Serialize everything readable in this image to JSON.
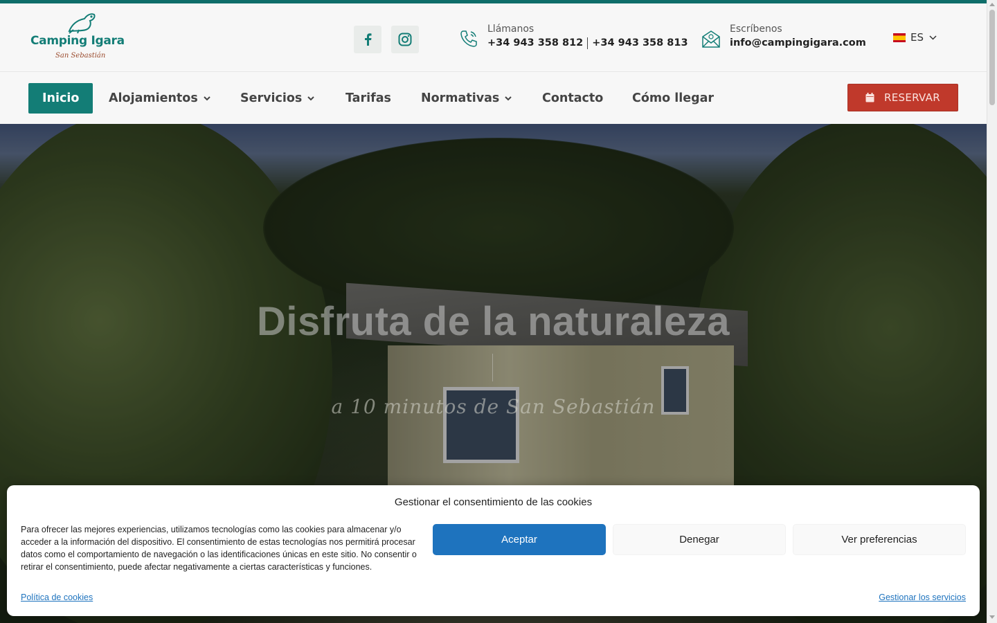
{
  "brand": {
    "name": "Camping Igara",
    "tagline": "San Sebastián",
    "color": "#137d76"
  },
  "header": {
    "social": [
      {
        "name": "facebook-icon"
      },
      {
        "name": "instagram-icon"
      }
    ],
    "phone": {
      "label": "Llámanos",
      "number1": "+34 943 358 812",
      "number2": "+34 943 358 813"
    },
    "email": {
      "label": "Escríbenos",
      "address": "info@campingigara.com"
    },
    "language": {
      "code": "ES",
      "flag": "spain-flag-icon"
    }
  },
  "nav": {
    "items": [
      {
        "label": "Inicio",
        "active": true
      },
      {
        "label": "Alojamientos",
        "dropdown": true
      },
      {
        "label": "Servicios",
        "dropdown": true
      },
      {
        "label": "Tarifas"
      },
      {
        "label": "Normativas",
        "dropdown": true
      },
      {
        "label": "Contacto"
      },
      {
        "label": "Cómo llegar"
      }
    ],
    "reserve_label": "RESERVAR",
    "reserve_color": "#c0392b"
  },
  "hero": {
    "title": "Disfruta de la naturaleza",
    "subtitle": "a 10 minutos de San Sebastián"
  },
  "cookie": {
    "title": "Gestionar el consentimiento de las cookies",
    "text": "Para ofrecer las mejores experiencias, utilizamos tecnologías como las cookies para almacenar y/o acceder a la información del dispositivo. El consentimiento de estas tecnologías nos permitirá procesar datos como el comportamiento de navegación o las identificaciones únicas en este sitio. No consentir o retirar el consentimiento, puede afectar negativamente a ciertas características y funciones.",
    "accept_label": "Aceptar",
    "deny_label": "Denegar",
    "prefs_label": "Ver preferencias",
    "policy_link": "Política de cookies",
    "manage_link": "Gestionar los servicios",
    "accept_color": "#1e73be"
  }
}
